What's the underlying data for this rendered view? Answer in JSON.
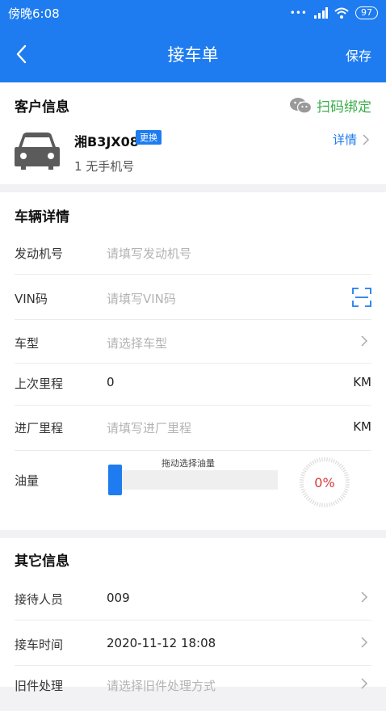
{
  "status_bar": {
    "time_text": "傍晚6:08",
    "battery": "97"
  },
  "nav": {
    "title": "接车单",
    "save_label": "保存"
  },
  "customer": {
    "section_title": "客户信息",
    "scan_bind_label": "扫码绑定",
    "plate": "湘B3JX08",
    "swap_label": "更换",
    "phone_text": "1 无手机号",
    "detail_label": "详情"
  },
  "vehicle": {
    "section_title": "车辆详情",
    "engine_label": "发动机号",
    "engine_placeholder": "请填写发动机号",
    "vin_label": "VIN码",
    "vin_placeholder": "请填写VIN码",
    "model_label": "车型",
    "model_placeholder": "请选择车型",
    "last_mileage_label": "上次里程",
    "last_mileage_value": "0",
    "last_mileage_unit": "KM",
    "entry_mileage_label": "进厂里程",
    "entry_mileage_placeholder": "请填写进厂里程",
    "entry_mileage_unit": "KM",
    "fuel_label": "油量",
    "fuel_hint": "拖动选择油量",
    "fuel_percent_text": "0%",
    "fuel_level": 0
  },
  "other": {
    "section_title": "其它信息",
    "receptionist_label": "接待人员",
    "receptionist_value": "009",
    "pickup_time_label": "接车时间",
    "pickup_time_value": "2020-11-12 18:08",
    "old_parts_label": "旧件处理",
    "old_parts_placeholder": "请选择旧件处理方式"
  },
  "colors": {
    "primary": "#1e7cf0",
    "green": "#3aae4a",
    "danger": "#d93a3a"
  }
}
